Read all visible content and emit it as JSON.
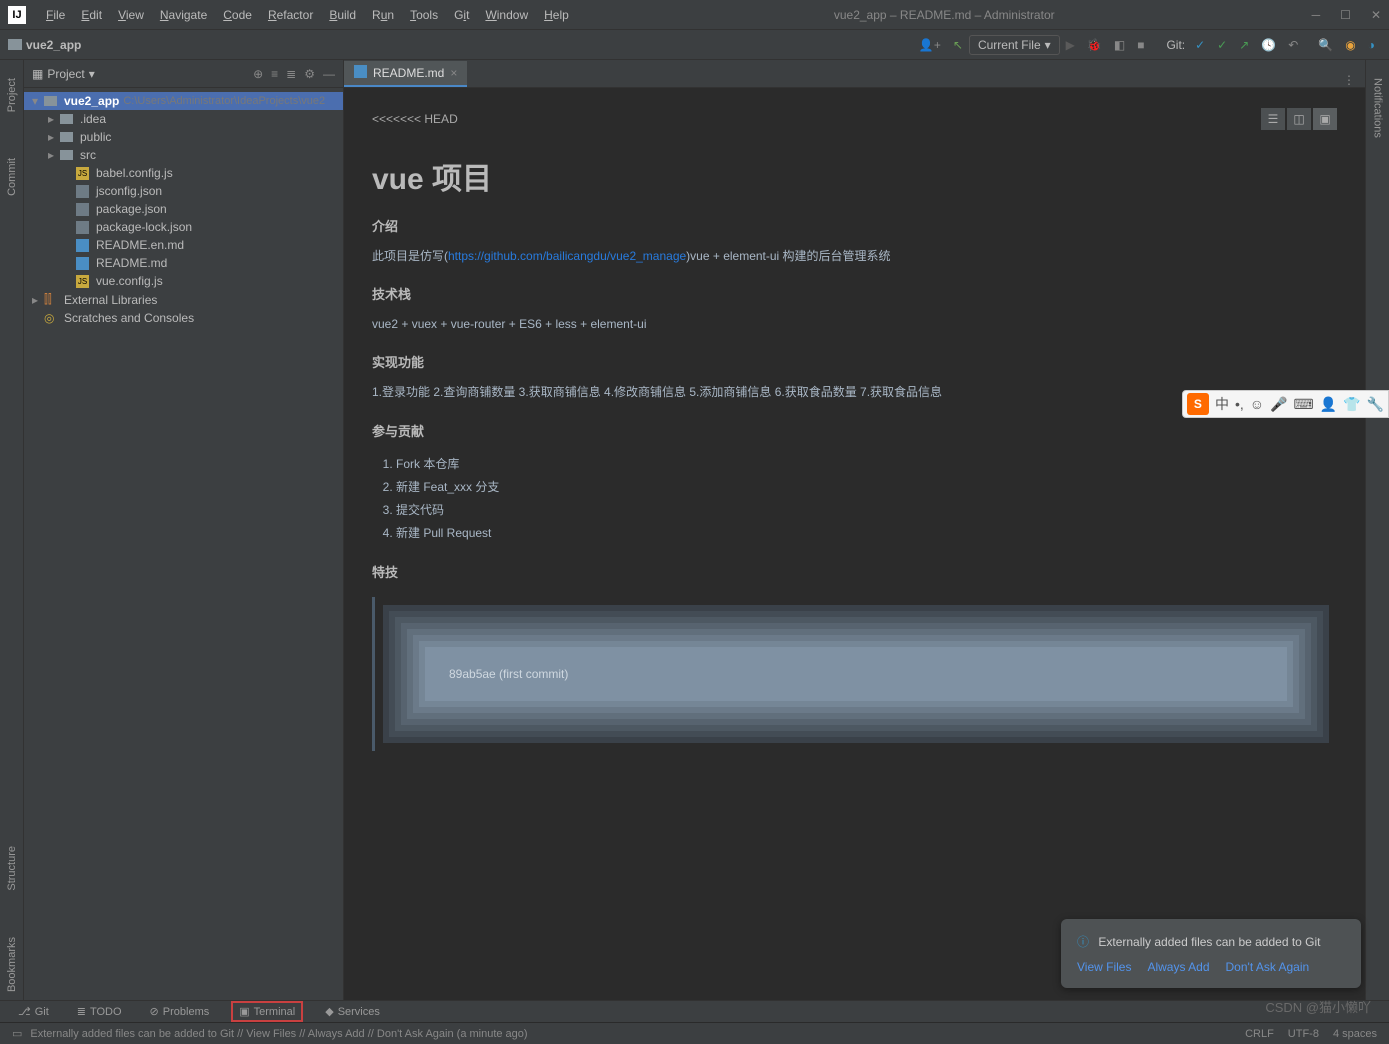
{
  "titlebar": {
    "menus": [
      "File",
      "Edit",
      "View",
      "Navigate",
      "Code",
      "Refactor",
      "Build",
      "Run",
      "Tools",
      "Git",
      "Window",
      "Help"
    ],
    "title": "vue2_app – README.md – Administrator"
  },
  "breadcrumb": {
    "root": "vue2_app"
  },
  "run_config": {
    "label": "Current File"
  },
  "toolbar": {
    "git_label": "Git:"
  },
  "project": {
    "panel_title": "Project",
    "root": {
      "name": "vue2_app",
      "path": "C:\\Users\\Administrator\\IdeaProjects\\vue2"
    },
    "folders": [
      ".idea",
      "public",
      "src"
    ],
    "files": [
      "babel.config.js",
      "jsconfig.json",
      "package.json",
      "package-lock.json",
      "README.en.md",
      "README.md",
      "vue.config.js"
    ],
    "external": "External Libraries",
    "scratches": "Scratches and Consoles"
  },
  "editor": {
    "tab": "README.md",
    "head_marker": "<<<<<<< HEAD",
    "h1": "vue 项目",
    "sections": {
      "intro_title": "介绍",
      "intro_pre": "此项目是仿写(",
      "intro_link": "https://github.com/bailicangdu/vue2_manage",
      "intro_post": ")vue + element-ui 构建的后台管理系统",
      "stack_title": "技术栈",
      "stack_text": "vue2 + vuex + vue-router + ES6 + less + element-ui",
      "features_title": "实现功能",
      "features_text": "1.登录功能 2.查询商铺数量 3.获取商铺信息 4.修改商铺信息 5.添加商铺信息 6.获取食品数量 7.获取食品信息",
      "contrib_title": "参与贡献",
      "contrib_items": [
        "Fork 本仓库",
        "新建 Feat_xxx 分支",
        "提交代码",
        "新建 Pull Request"
      ],
      "tricks_title": "特技",
      "commit_text": "89ab5ae (first commit)"
    }
  },
  "left_rail": [
    "Project",
    "Commit",
    "Structure",
    "Bookmarks"
  ],
  "right_rail": [
    "Notifications"
  ],
  "notification": {
    "message": "Externally added files can be added to Git",
    "actions": [
      "View Files",
      "Always Add",
      "Don't Ask Again"
    ]
  },
  "bottom_tools": [
    "Git",
    "TODO",
    "Problems",
    "Terminal",
    "Services"
  ],
  "status": {
    "message": "Externally added files can be added to Git // View Files // Always Add // Don't Ask Again (a minute ago)",
    "right": [
      "CRLF",
      "UTF-8",
      "4 spaces"
    ]
  },
  "ime": {
    "logo": "S",
    "items": [
      "中",
      "•,",
      "☺",
      "🎤",
      "⌨",
      "👤",
      "👕",
      "🔧"
    ]
  },
  "watermark": "CSDN @猫小懒吖"
}
